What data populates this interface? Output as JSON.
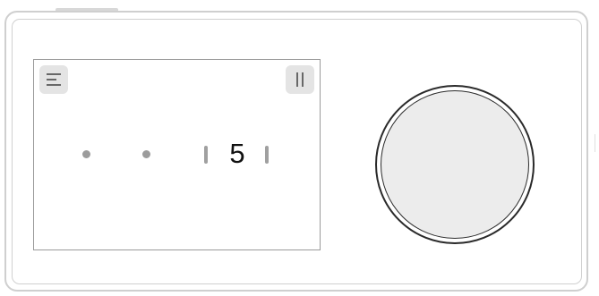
{
  "device": {
    "screen": {
      "menu_icon": "menu-icon",
      "pause_icon": "pause-icon",
      "selector": {
        "selected_value": "5",
        "position_count": 3,
        "selected_index": 2
      }
    },
    "knob": {
      "icon": "rotary-knob"
    }
  }
}
